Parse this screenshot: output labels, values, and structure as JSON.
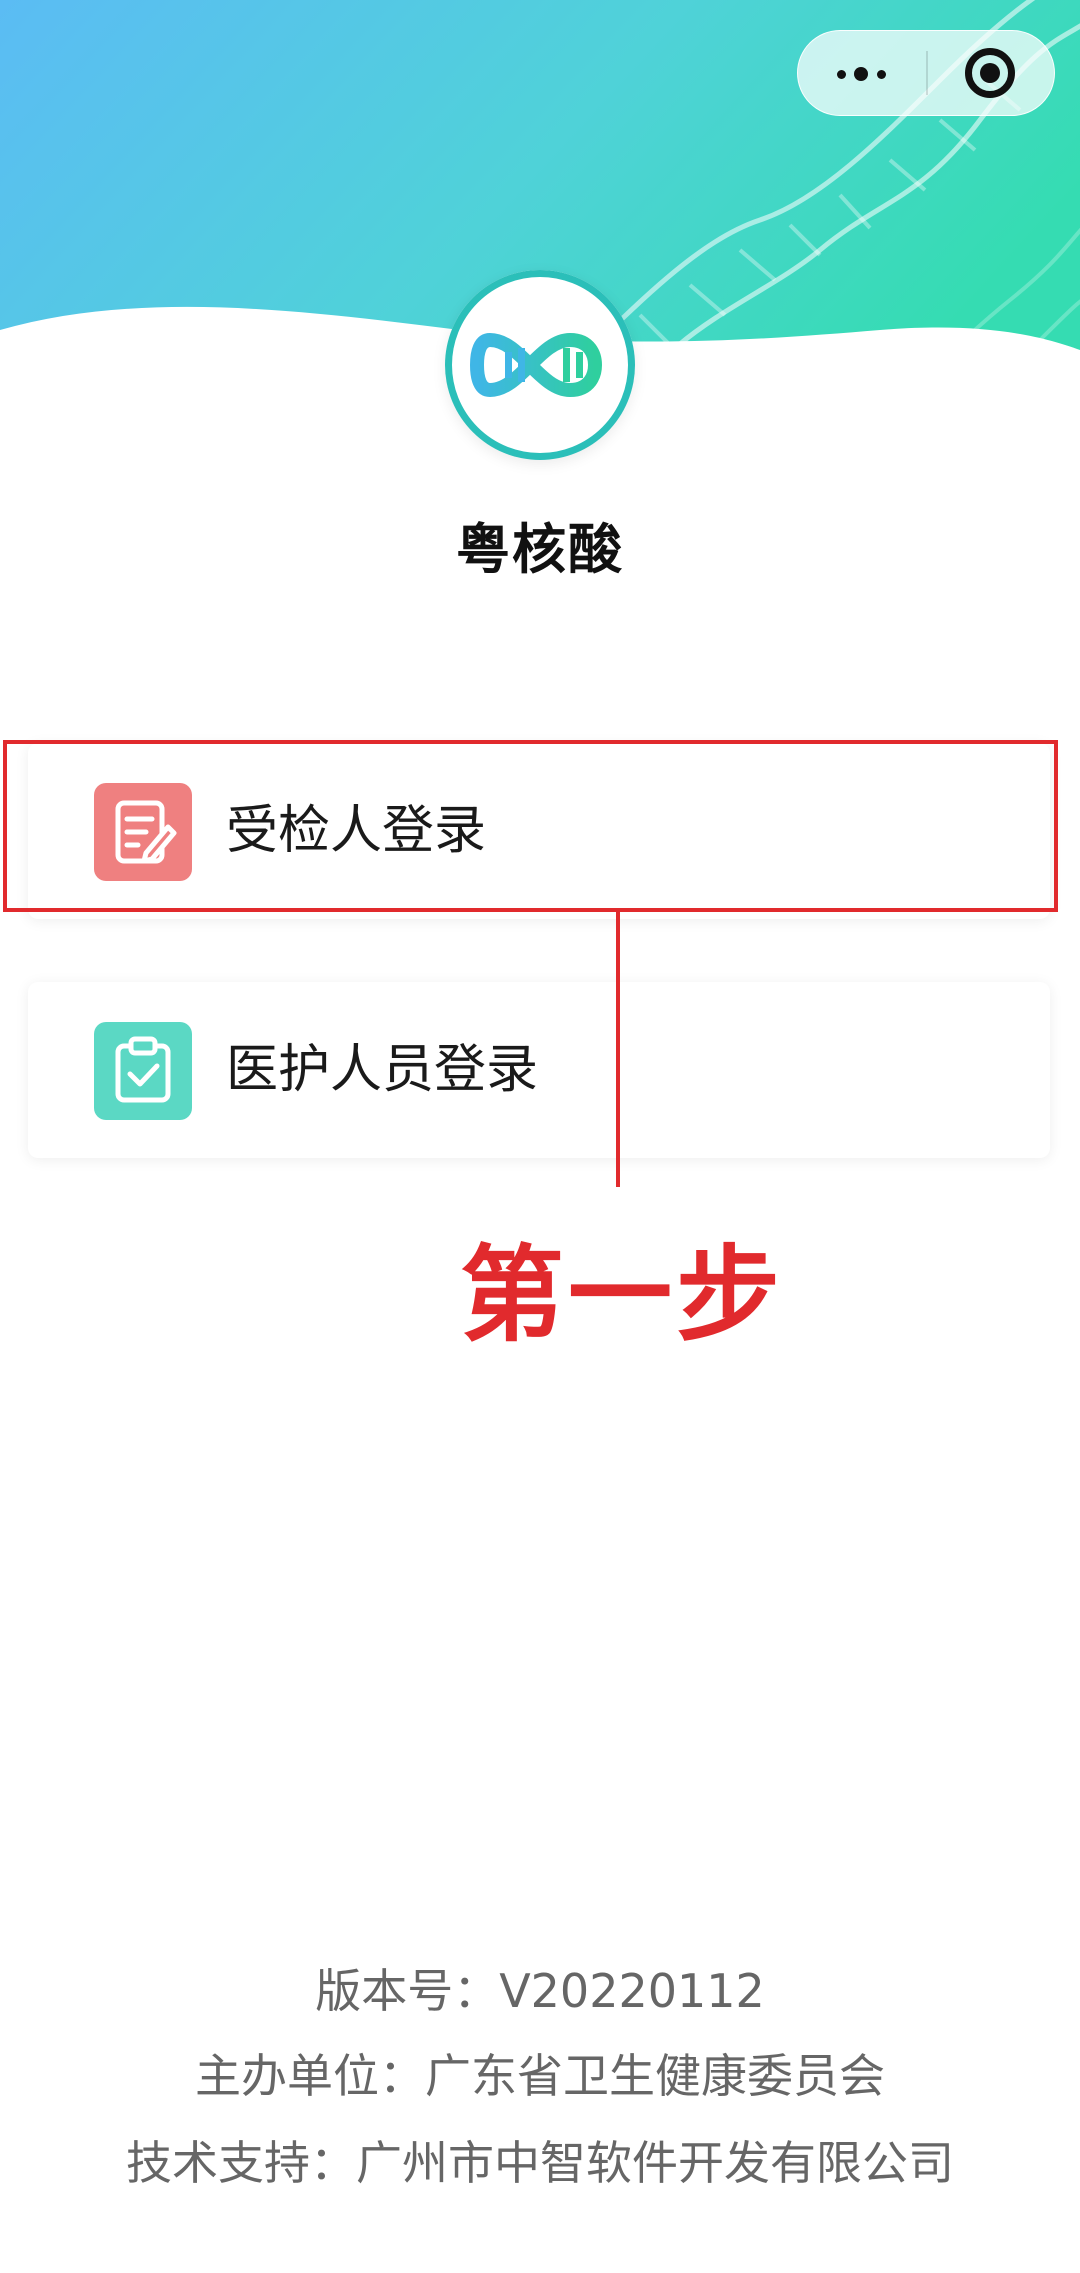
{
  "app": {
    "title": "粤核酸"
  },
  "capsule": {
    "more_icon": "more-dots-icon",
    "close_icon": "target-close-icon"
  },
  "login_options": [
    {
      "label": "受检人登录",
      "icon": "edit-document-icon",
      "color": "#ef8080"
    },
    {
      "label": "医护人员登录",
      "icon": "clipboard-check-icon",
      "color": "#5bd8c4"
    }
  ],
  "annotation": {
    "step_text": "第一步",
    "color": "#e12a2d"
  },
  "footer": {
    "version": "版本号：V20220112",
    "organizer": "主办单位：广东省卫生健康委员会",
    "support": "技术支持：广州市中智软件开发有限公司"
  },
  "theme": {
    "gradient_start": "#5bbcf4",
    "gradient_end": "#35dcb2",
    "logo_accent": "#2bbfb9"
  }
}
